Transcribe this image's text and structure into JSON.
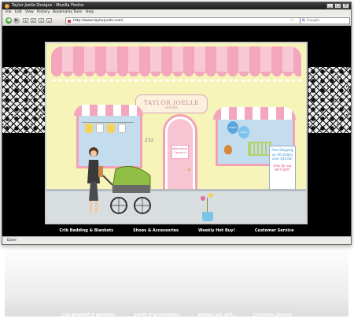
{
  "window": {
    "title": "Taylor Joelle Designs - Mozilla Firefox",
    "controls": [
      "_",
      "□",
      "×"
    ]
  },
  "menu": [
    "File",
    "Edit",
    "View",
    "History",
    "Bookmarks",
    "Tools",
    "Help"
  ],
  "navigation": {
    "back_icon": "back-arrow-icon",
    "url": "http://www.taylorjoelle.com/",
    "search_placeholder": "Google",
    "search_engine_glyph": "G"
  },
  "page": {
    "shop_sign_name": "TAYLOR JOELLE",
    "shop_sign_sub": "DESIGNS",
    "address": "232",
    "door_sign": "Welcome! Come In",
    "promo": {
      "line1": "Free Shipping on All Orders over $35.00!",
      "line2": "click for our HOT BUY!"
    },
    "balloons": [
      "mom",
      "baby"
    ],
    "nav_links": [
      "Crib Bedding & Blankets",
      "Shoes & Accessories",
      "Weekly Hot Buy!",
      "Customer Service"
    ]
  },
  "status": {
    "text": "Done"
  },
  "colors": {
    "awning_pink": "#f3a6bc",
    "wall_yellow": "#f7f4b9",
    "background": "#000000"
  }
}
